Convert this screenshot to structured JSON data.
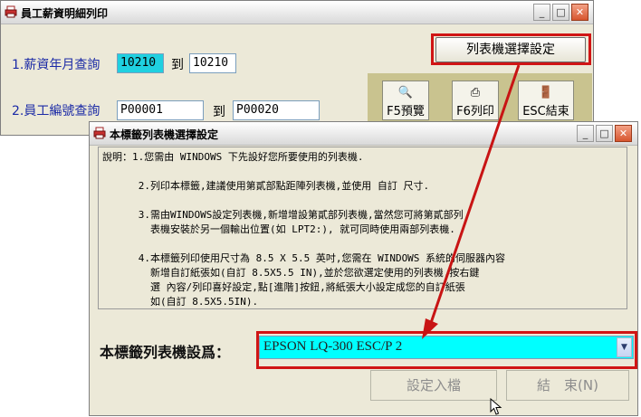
{
  "main_window": {
    "title": "員工薪資明細列印",
    "controls": {
      "minimize": "_",
      "maximize": "□",
      "close": "✕"
    },
    "salary_query": {
      "label": "1.薪資年月查詢",
      "from_value": "10210",
      "to_label": "到",
      "to_value": "10210"
    },
    "employee_query": {
      "label": "2.員工編號查詢",
      "from_value": "P00001",
      "to_label": "到",
      "to_value": "P00020"
    },
    "printer_select_button": "列表機選擇設定",
    "toolbar": {
      "preview": "F5預覽",
      "print": "F6列印",
      "exit": "ESC結束"
    }
  },
  "dialog": {
    "title": "本標籤列表機選擇設定",
    "controls": {
      "minimize": "_",
      "maximize": "□",
      "close": "✕"
    },
    "notes": [
      "說明：1.您需由 WINDOWS 下先設好您所要使用的列表機.",
      "",
      "      2.列印本標籤,建議使用第貳部點距陣列表機,並使用 自訂 尺寸.",
      "",
      "      3.需由WINDOWS設定列表機,新增增設第貳部列表機,當然您可將第貳部列",
      "        表機安裝於另一個輸出位置(如 LPT2:), 就可同時使用兩部列表機.",
      "",
      "      4.本標籤列印使用尺寸為 8.5 X 5.5 英吋,您需在 WINDOWS 系統的伺服器內容",
      "        新增自訂紙張如(自訂 8.5X5.5 IN),並於您欲選定使用的列表機,按右鍵",
      "        選 內容/列印喜好設定,點[進階]按鈕,將紙張大小設定成您的自訂紙張",
      "        如(自訂 8.5X5.5IN)."
    ],
    "printer_label": "本標籤列表機設爲：",
    "printer_value": "EPSON LQ-300 ESC/P 2",
    "save_button": "設定入檔",
    "exit_button": "結　束(N)"
  },
  "colors": {
    "accent_red": "#d01515",
    "selected_cyan": "#00ffff",
    "label_blue": "#1b2aa6"
  }
}
